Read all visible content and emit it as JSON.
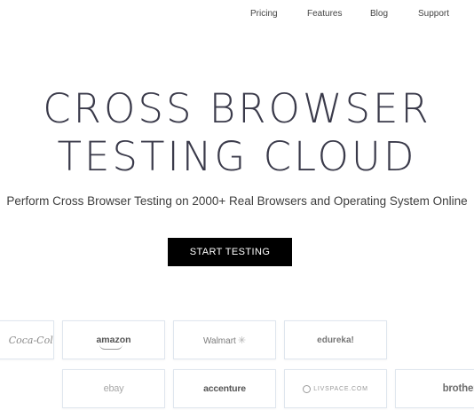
{
  "nav": {
    "items": [
      {
        "label": "Pricing"
      },
      {
        "label": "Features"
      },
      {
        "label": "Blog"
      },
      {
        "label": "Support"
      }
    ]
  },
  "hero": {
    "title_line1": "CROSS BROWSER",
    "title_line2": "TESTING CLOUD",
    "subtitle": "Perform Cross Browser Testing on 2000+ Real Browsers and Operating System Online",
    "cta_label": "START TESTING"
  },
  "logos": {
    "row1": [
      {
        "name": "coca-cola",
        "text": "Coca-Cola"
      },
      {
        "name": "amazon",
        "text": "amazon"
      },
      {
        "name": "walmart",
        "text": "Walmart"
      },
      {
        "name": "edureka",
        "text": "edureka!"
      }
    ],
    "row2": [
      {
        "name": "ebay",
        "text": "ebay"
      },
      {
        "name": "accenture",
        "text": "accenture"
      },
      {
        "name": "livspace",
        "text": "LIVSPACE.COM"
      },
      {
        "name": "brother",
        "text": "brother"
      }
    ]
  },
  "colors": {
    "title": "#3a3a4a",
    "cta_bg": "#000000",
    "cta_text": "#ffffff",
    "card_border": "#dfe6ee"
  },
  "icons": {
    "walmart_spark": "spark-icon",
    "livspace_ring": "ring-icon"
  }
}
